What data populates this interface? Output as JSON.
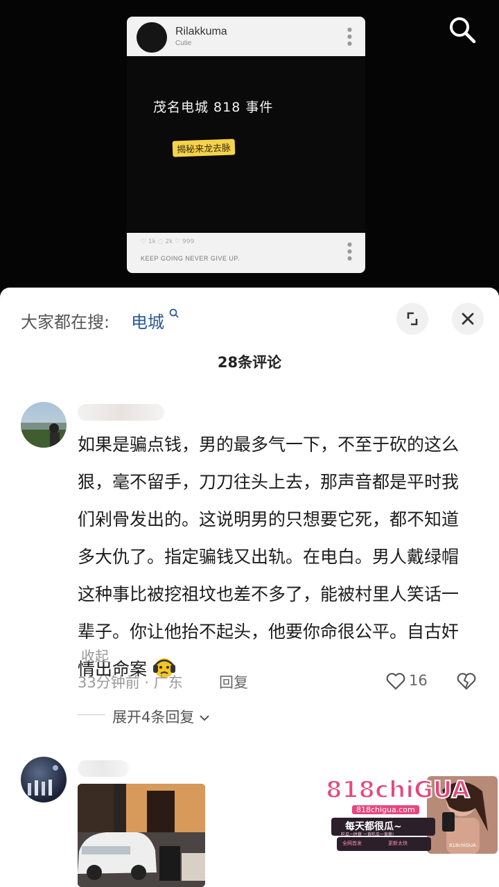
{
  "video": {
    "card_username": "Rilakkuma",
    "card_subtitle": "Cutie",
    "card_title": "茂名电城 818 事件",
    "card_tag": "揭秘来龙去脉",
    "card_motto": "KEEP GOING NEVER GIVE UP.",
    "card_stats": "♡ 1k    ◌ 2k    ♡ 999",
    "search_icon": "search-icon"
  },
  "sheet": {
    "trending_label": "大家都在搜: ",
    "trending_keyword": "电城",
    "expand_icon": "expand-icon",
    "close_icon": "close-icon",
    "comment_count": "28条评论"
  },
  "comments": [
    {
      "text": "如果是骗点钱，男的最多气一下，不至于砍的这么狠，毫不留手，刀刀往头上去，那声音都是平时我们剁骨发出的。这说明男的只想要它死，都不知道多大仇了。指定骗钱又出轨。在电白。男人戴绿帽这种事比被挖祖坟也差不多了，能被村里人笑话一辈子。你让他抬不起头，他要你命很公平。自古奸情出命案",
      "collapse": "收起",
      "time_location": "33分钟前 · 广东",
      "reply": "回复",
      "likes": "16",
      "expand_replies": "展开4条回复"
    },
    {}
  ],
  "watermark": {
    "brand": "818chiGUA",
    "domain": "818chigua.com",
    "slogan": "每天都很瓜~",
    "tagline": "吃瓜一时爽 一直吃瓜一直爽!",
    "badge1": "全网首发",
    "badge2": "更新太快",
    "badge3": "818chiGUA"
  },
  "colors": {
    "link": "#2b5a94",
    "watermark_pink": "#e8467c"
  }
}
